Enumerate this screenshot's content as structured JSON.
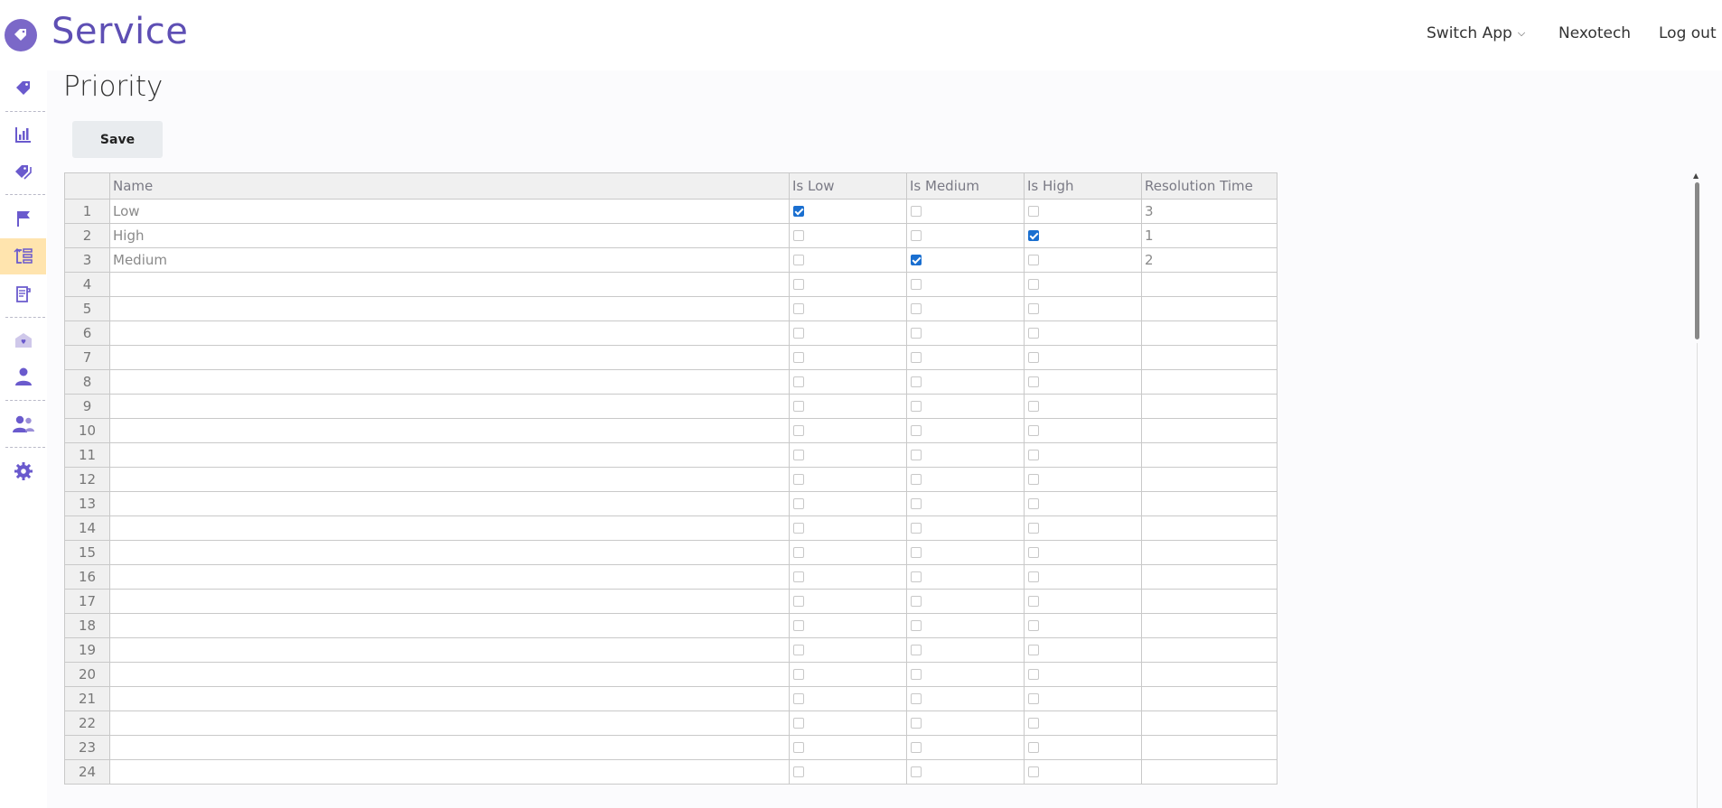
{
  "app": {
    "title": "Service"
  },
  "nav": {
    "switch_app": "Switch App",
    "company": "Nexotech",
    "logout": "Log out"
  },
  "sidebar": {
    "items": [
      {
        "icon": "tag-icon"
      },
      {
        "icon": "bar-chart-icon"
      },
      {
        "icon": "tags-icon"
      },
      {
        "icon": "flag-icon"
      },
      {
        "icon": "priority-list-icon",
        "active": true
      },
      {
        "icon": "receipt-icon"
      },
      {
        "icon": "mail-heart-icon"
      },
      {
        "icon": "user-icon"
      },
      {
        "icon": "users-icon"
      },
      {
        "icon": "gear-icon"
      }
    ]
  },
  "page": {
    "title": "Priority",
    "save_label": "Save"
  },
  "colors": {
    "accent": "#5e4fb4",
    "active_bg": "#ffe4ae",
    "checkbox": "#1a6fd0"
  },
  "table": {
    "columns": [
      "Name",
      "Is Low",
      "Is Medium",
      "Is High",
      "Resolution Time"
    ],
    "rows": [
      {
        "num": "1",
        "name": "Low",
        "is_low": true,
        "is_medium": false,
        "is_high": false,
        "resolution": "3"
      },
      {
        "num": "2",
        "name": "High",
        "is_low": false,
        "is_medium": false,
        "is_high": true,
        "resolution": "1"
      },
      {
        "num": "3",
        "name": "Medium",
        "is_low": false,
        "is_medium": true,
        "is_high": false,
        "resolution": "2"
      },
      {
        "num": "4",
        "name": "",
        "is_low": false,
        "is_medium": false,
        "is_high": false,
        "resolution": ""
      },
      {
        "num": "5",
        "name": "",
        "is_low": false,
        "is_medium": false,
        "is_high": false,
        "resolution": ""
      },
      {
        "num": "6",
        "name": "",
        "is_low": false,
        "is_medium": false,
        "is_high": false,
        "resolution": ""
      },
      {
        "num": "7",
        "name": "",
        "is_low": false,
        "is_medium": false,
        "is_high": false,
        "resolution": ""
      },
      {
        "num": "8",
        "name": "",
        "is_low": false,
        "is_medium": false,
        "is_high": false,
        "resolution": ""
      },
      {
        "num": "9",
        "name": "",
        "is_low": false,
        "is_medium": false,
        "is_high": false,
        "resolution": ""
      },
      {
        "num": "10",
        "name": "",
        "is_low": false,
        "is_medium": false,
        "is_high": false,
        "resolution": ""
      },
      {
        "num": "11",
        "name": "",
        "is_low": false,
        "is_medium": false,
        "is_high": false,
        "resolution": ""
      },
      {
        "num": "12",
        "name": "",
        "is_low": false,
        "is_medium": false,
        "is_high": false,
        "resolution": ""
      },
      {
        "num": "13",
        "name": "",
        "is_low": false,
        "is_medium": false,
        "is_high": false,
        "resolution": ""
      },
      {
        "num": "14",
        "name": "",
        "is_low": false,
        "is_medium": false,
        "is_high": false,
        "resolution": ""
      },
      {
        "num": "15",
        "name": "",
        "is_low": false,
        "is_medium": false,
        "is_high": false,
        "resolution": ""
      },
      {
        "num": "16",
        "name": "",
        "is_low": false,
        "is_medium": false,
        "is_high": false,
        "resolution": ""
      },
      {
        "num": "17",
        "name": "",
        "is_low": false,
        "is_medium": false,
        "is_high": false,
        "resolution": ""
      },
      {
        "num": "18",
        "name": "",
        "is_low": false,
        "is_medium": false,
        "is_high": false,
        "resolution": ""
      },
      {
        "num": "19",
        "name": "",
        "is_low": false,
        "is_medium": false,
        "is_high": false,
        "resolution": ""
      },
      {
        "num": "20",
        "name": "",
        "is_low": false,
        "is_medium": false,
        "is_high": false,
        "resolution": ""
      },
      {
        "num": "21",
        "name": "",
        "is_low": false,
        "is_medium": false,
        "is_high": false,
        "resolution": ""
      },
      {
        "num": "22",
        "name": "",
        "is_low": false,
        "is_medium": false,
        "is_high": false,
        "resolution": ""
      },
      {
        "num": "23",
        "name": "",
        "is_low": false,
        "is_medium": false,
        "is_high": false,
        "resolution": ""
      },
      {
        "num": "24",
        "name": "",
        "is_low": false,
        "is_medium": false,
        "is_high": false,
        "resolution": ""
      }
    ]
  }
}
